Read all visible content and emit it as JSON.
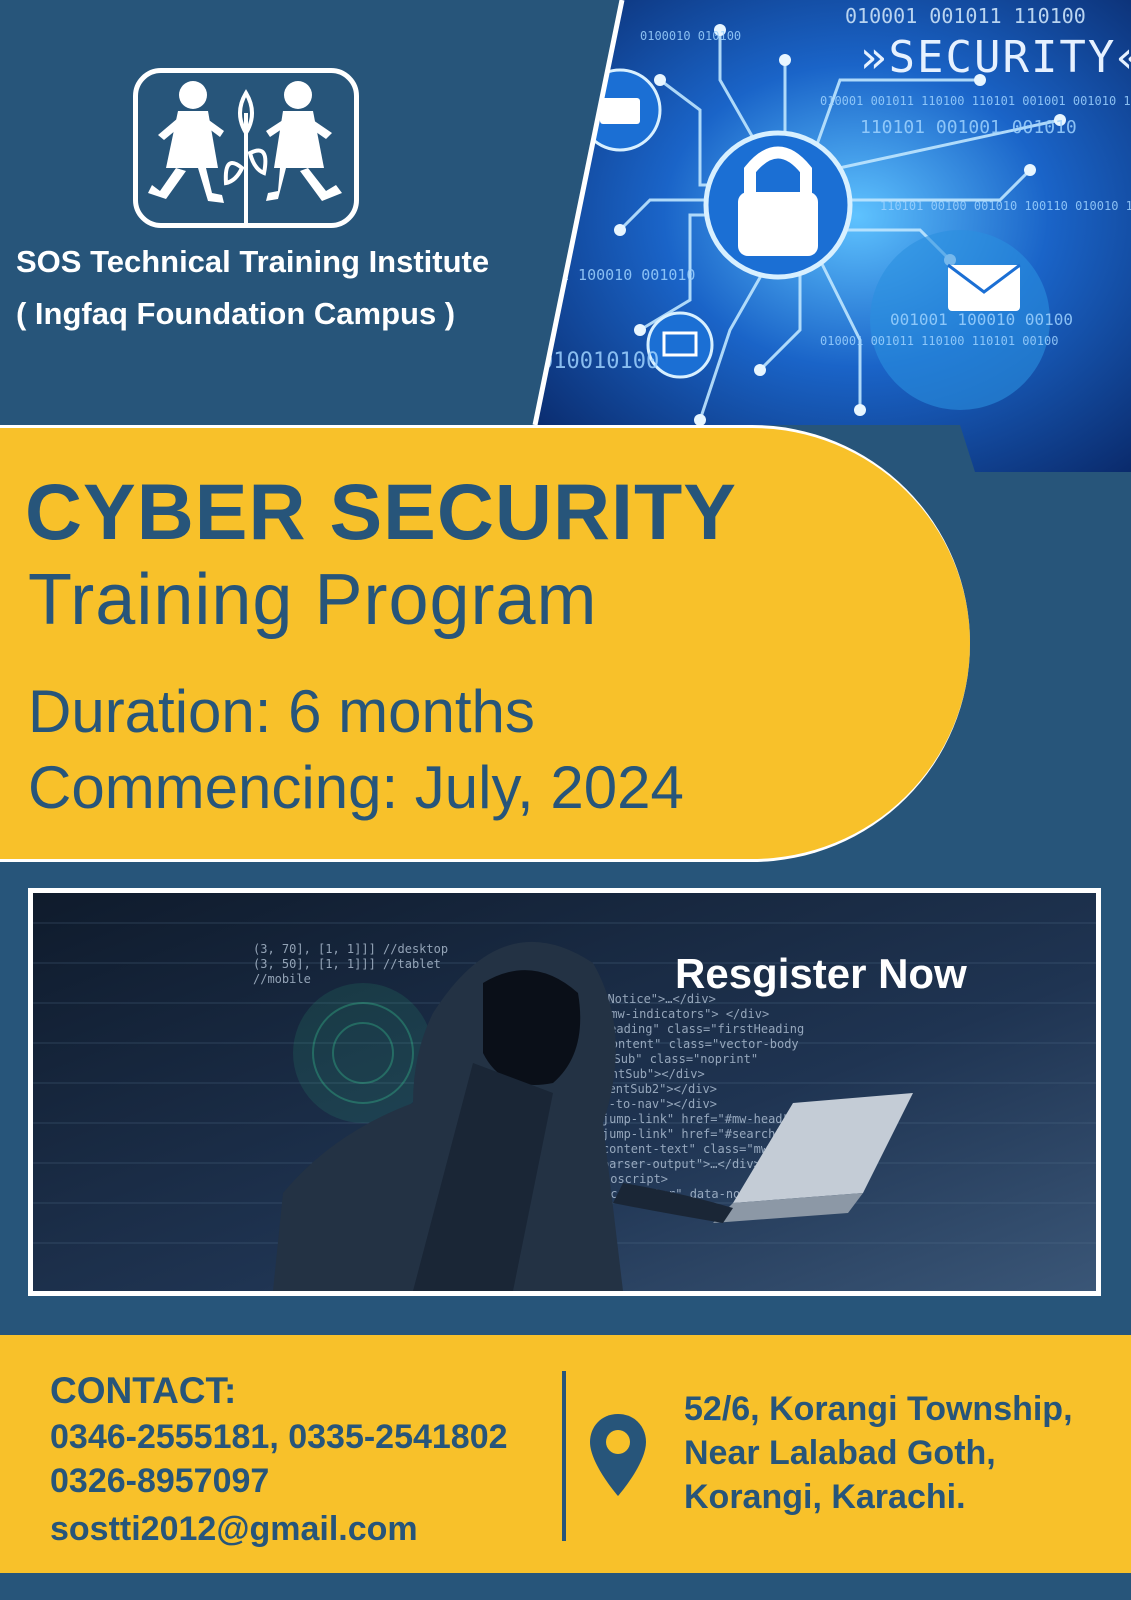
{
  "institute": {
    "name": "SOS Technical Training Institute",
    "campus": "( Ingfaq Foundation Campus )"
  },
  "security_banner": {
    "word": "»SECURITY«",
    "binary": "010001 001011 110100"
  },
  "program": {
    "title_line1": "CYBER SECURITY",
    "title_line2": "Training Program",
    "duration": "Duration: 6 months",
    "commencing": "Commencing: July, 2024"
  },
  "photo": {
    "cta": "Resgister Now"
  },
  "contact": {
    "heading": "CONTACT:",
    "phones_line1": "0346-2555181, 0335-2541802",
    "phones_line2": "0326-8957097",
    "email": "sostti2012@gmail.com"
  },
  "address": {
    "line1": "52/6, Korangi Township,",
    "line2": "Near Lalabad Goth,",
    "line3": "Korangi, Karachi."
  },
  "colors": {
    "navy": "#27557a",
    "yellow": "#f8c12a",
    "white": "#ffffff"
  }
}
